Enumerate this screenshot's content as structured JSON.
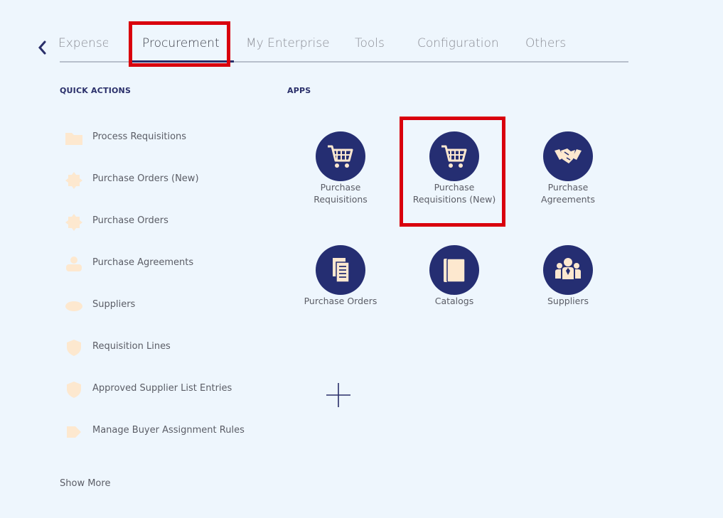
{
  "tabs": [
    {
      "label": "Expenses"
    },
    {
      "label": "Procurement",
      "active": true
    },
    {
      "label": "My Enterprise"
    },
    {
      "label": "Tools"
    },
    {
      "label": "Configuration"
    },
    {
      "label": "Others"
    }
  ],
  "quick_actions": {
    "heading": "QUICK ACTIONS",
    "items": [
      {
        "label": "Process Requisitions",
        "icon": "folder-icon"
      },
      {
        "label": "Purchase Orders (New)",
        "icon": "badge-icon"
      },
      {
        "label": "Purchase Orders",
        "icon": "badge-icon"
      },
      {
        "label": "Purchase Agreements",
        "icon": "people-icon"
      },
      {
        "label": "Suppliers",
        "icon": "people-icon"
      },
      {
        "label": "Requisition Lines",
        "icon": "shield-icon"
      },
      {
        "label": "Approved Supplier List Entries",
        "icon": "shield-icon"
      },
      {
        "label": "Manage Buyer Assignment Rules",
        "icon": "tag-icon"
      }
    ],
    "show_more": "Show More"
  },
  "apps": {
    "heading": "APPS",
    "items": [
      {
        "line1": "Purchase",
        "line2": "Requisitions",
        "icon": "cart-icon"
      },
      {
        "line1": "Purchase",
        "line2": "Requisitions (New)",
        "icon": "cart-icon"
      },
      {
        "line1": "Purchase",
        "line2": "Agreements",
        "icon": "handshake-icon"
      },
      {
        "line1": "Purchase Orders",
        "line2": "",
        "icon": "document-icon"
      },
      {
        "line1": "Catalogs",
        "line2": "",
        "icon": "catalog-icon"
      },
      {
        "line1": "Suppliers",
        "line2": "",
        "icon": "team-icon"
      }
    ]
  },
  "colors": {
    "background": "#eef6fd",
    "app_circle": "#252e72",
    "icon_fill": "#fde8cf",
    "highlight": "#d9000d"
  }
}
